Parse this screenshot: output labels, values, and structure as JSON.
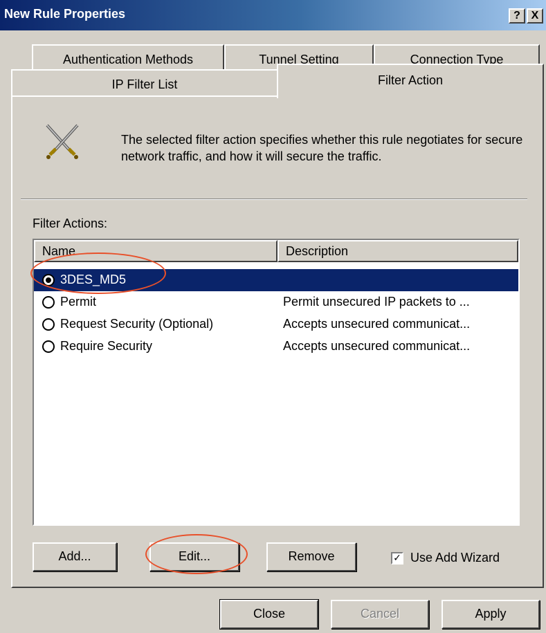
{
  "window": {
    "title": "New Rule Properties",
    "help_button": "?",
    "close_button": "X"
  },
  "tabs": {
    "row_back": [
      "Authentication Methods",
      "Tunnel Setting",
      "Connection Type"
    ],
    "row_front": [
      "IP Filter List",
      "Filter Action"
    ],
    "active": "Filter Action"
  },
  "header": {
    "icon": "crossed-swords-icon",
    "description": "The selected filter action specifies whether this rule negotiates for secure network traffic, and how it will secure the traffic."
  },
  "filter_actions": {
    "label": "Filter Actions:",
    "columns": [
      "Name",
      "Description"
    ],
    "rows": [
      {
        "name": "3DES_MD5",
        "description": "",
        "selected": true
      },
      {
        "name": "Permit",
        "description": "Permit unsecured IP packets to ...",
        "selected": false
      },
      {
        "name": "Request Security (Optional)",
        "description": "Accepts unsecured communicat...",
        "selected": false
      },
      {
        "name": "Require Security",
        "description": "Accepts unsecured communicat...",
        "selected": false
      }
    ]
  },
  "actions": {
    "add": "Add...",
    "edit": "Edit...",
    "remove": "Remove",
    "use_add_wizard": "Use Add Wizard",
    "use_add_wizard_checked": true
  },
  "footer": {
    "close": "Close",
    "cancel": "Cancel",
    "apply": "Apply"
  },
  "colors": {
    "selection": "#0a246a",
    "annotation": "#e8502a"
  }
}
